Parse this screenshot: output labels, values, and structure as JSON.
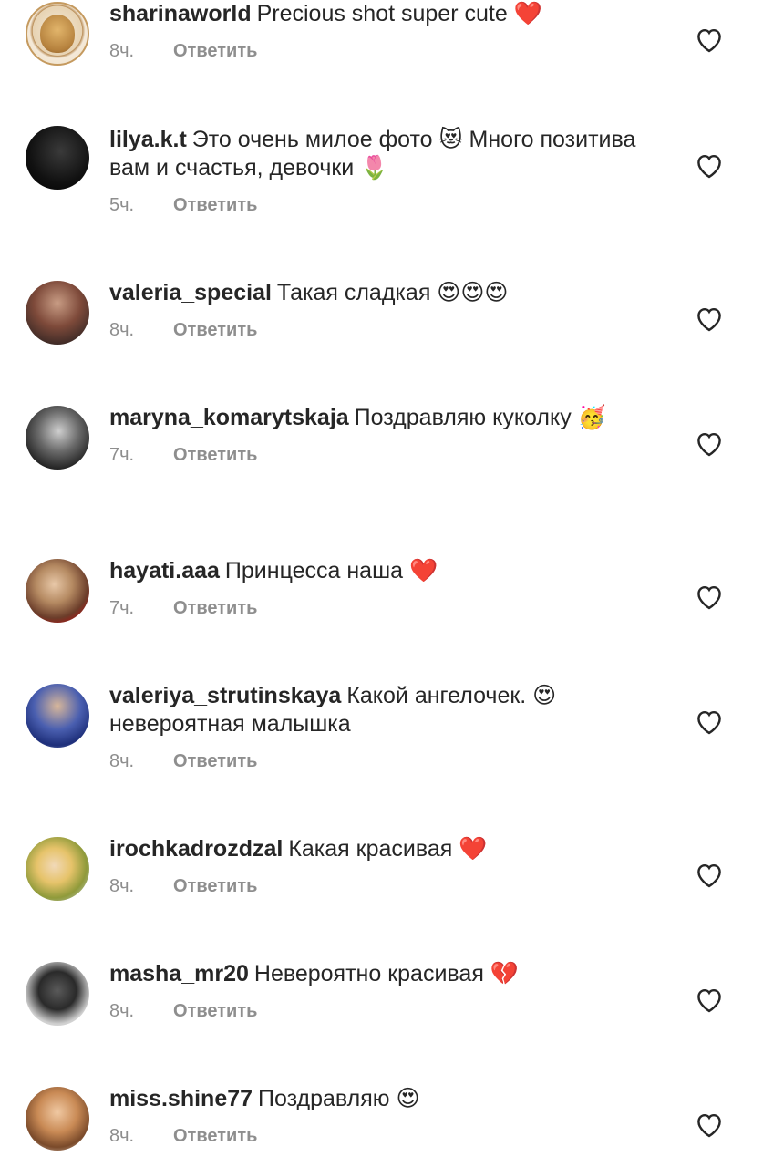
{
  "reply_label": "Ответить",
  "comments": [
    {
      "username": "sharinaworld",
      "text": "Precious shot super cute ❤️",
      "time": "8ч."
    },
    {
      "username": "lilya.k.t",
      "text": "Это очень милое фото 😻 Много позитива вам и счастья, девочки 🌷",
      "time": "5ч."
    },
    {
      "username": "valeria_special",
      "text": "Такая сладкая 😍😍😍",
      "time": "8ч."
    },
    {
      "username": "maryna_komarytskaja",
      "text": "Поздравляю куколку 🥳",
      "time": "7ч."
    },
    {
      "username": "hayati.aaa",
      "text": "Принцесса наша ❤️",
      "time": "7ч."
    },
    {
      "username": "valeriya_strutinskaya",
      "text": "Какой ангелочек. 😍 невероятная малышка",
      "time": "8ч."
    },
    {
      "username": "irochkadrozdzal",
      "text": "Какая красивая ❤️",
      "time": "8ч."
    },
    {
      "username": "masha_mr20",
      "text": "Невероятно красивая 💔",
      "time": "8ч."
    },
    {
      "username": "miss.shine77",
      "text": "Поздравляю 😍",
      "time": "8ч."
    }
  ],
  "icons": {
    "like": "heart-outline-icon"
  }
}
